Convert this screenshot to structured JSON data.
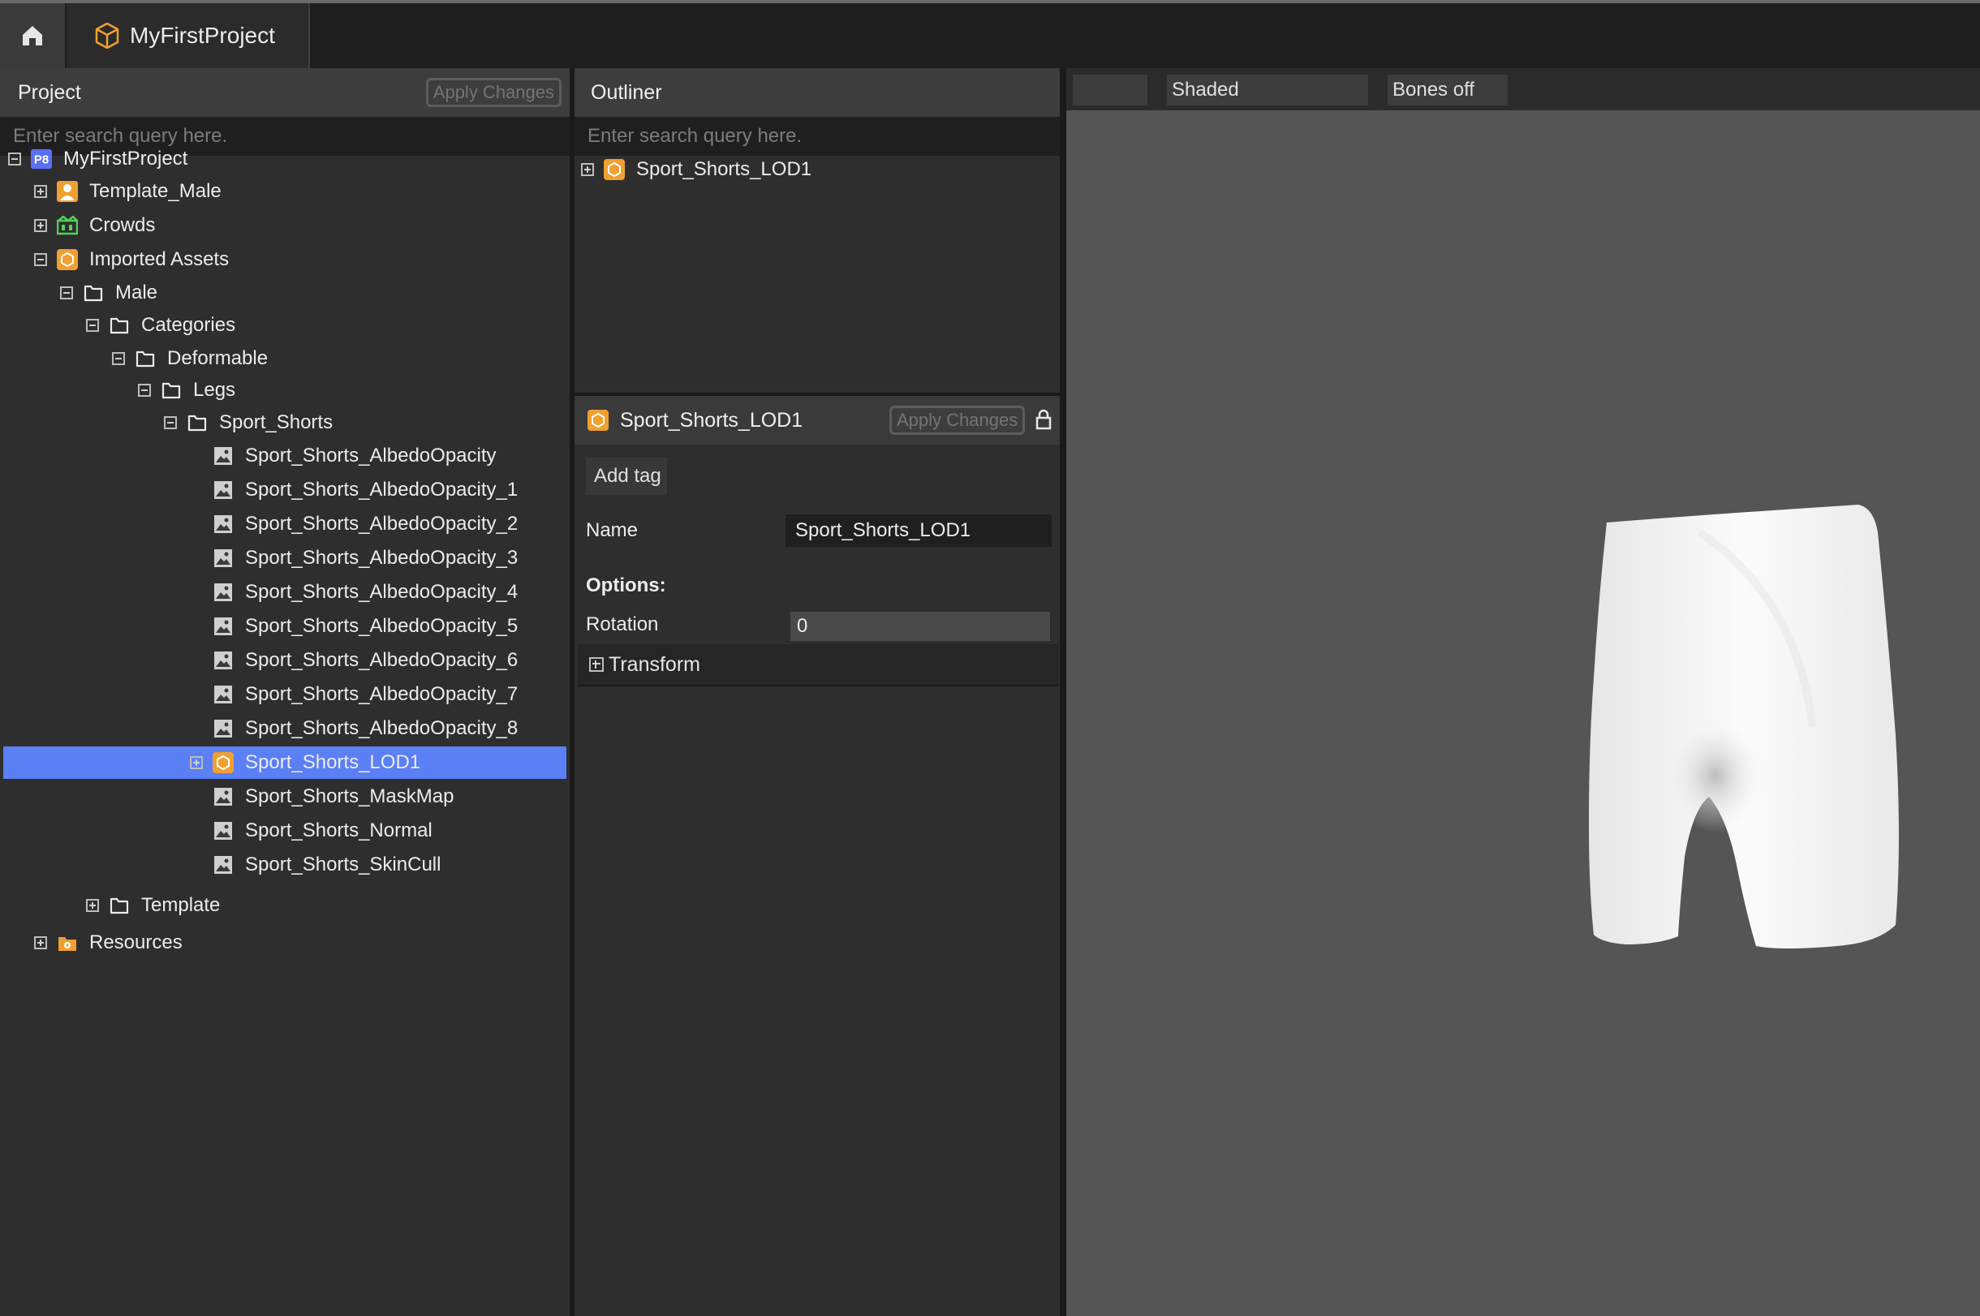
{
  "tabs": {
    "project_tab_label": "MyFirstProject"
  },
  "project_panel": {
    "title": "Project",
    "apply_label": "Apply Changes",
    "search_placeholder": "Enter search query here.",
    "tree": [
      {
        "label": "MyFirstProject",
        "icon": "p8-project-icon",
        "toggle": "minus"
      },
      {
        "label": "Template_Male",
        "icon": "person-icon",
        "toggle": "plus"
      },
      {
        "label": "Crowds",
        "icon": "crowds-icon",
        "toggle": "plus"
      },
      {
        "label": "Imported Assets",
        "icon": "hexagon-asset-icon",
        "toggle": "minus"
      },
      {
        "label": "Male",
        "icon": "folder-icon",
        "toggle": "minus"
      },
      {
        "label": "Categories",
        "icon": "folder-icon",
        "toggle": "minus"
      },
      {
        "label": "Deformable",
        "icon": "folder-icon",
        "toggle": "minus"
      },
      {
        "label": "Legs",
        "icon": "folder-icon",
        "toggle": "minus"
      },
      {
        "label": "Sport_Shorts",
        "icon": "folder-icon",
        "toggle": "minus"
      },
      {
        "label": "Sport_Shorts_AlbedoOpacity",
        "icon": "image-icon"
      },
      {
        "label": "Sport_Shorts_AlbedoOpacity_1",
        "icon": "image-icon"
      },
      {
        "label": "Sport_Shorts_AlbedoOpacity_2",
        "icon": "image-icon"
      },
      {
        "label": "Sport_Shorts_AlbedoOpacity_3",
        "icon": "image-icon"
      },
      {
        "label": "Sport_Shorts_AlbedoOpacity_4",
        "icon": "image-icon"
      },
      {
        "label": "Sport_Shorts_AlbedoOpacity_5",
        "icon": "image-icon"
      },
      {
        "label": "Sport_Shorts_AlbedoOpacity_6",
        "icon": "image-icon"
      },
      {
        "label": "Sport_Shorts_AlbedoOpacity_7",
        "icon": "image-icon"
      },
      {
        "label": "Sport_Shorts_AlbedoOpacity_8",
        "icon": "image-icon"
      },
      {
        "label": "Sport_Shorts_LOD1",
        "icon": "hexagon-asset-icon",
        "toggle": "plus",
        "selected": true
      },
      {
        "label": "Sport_Shorts_MaskMap",
        "icon": "image-icon"
      },
      {
        "label": "Sport_Shorts_Normal",
        "icon": "image-icon"
      },
      {
        "label": "Sport_Shorts_SkinCull",
        "icon": "image-icon"
      },
      {
        "label": "Template",
        "icon": "folder-icon",
        "toggle": "plus"
      },
      {
        "label": "Resources",
        "icon": "resources-icon",
        "toggle": "plus"
      }
    ]
  },
  "outliner": {
    "title": "Outliner",
    "search_placeholder": "Enter search query here.",
    "item_label": "Sport_Shorts_LOD1"
  },
  "inspector": {
    "title": "Sport_Shorts_LOD1",
    "apply_label": "Apply Changes",
    "add_tag_label": "Add tag",
    "name_label": "Name",
    "name_value": "Sport_Shorts_LOD1",
    "options_label": "Options:",
    "rotation_label": "Rotation",
    "rotation_value": "0",
    "transform_label": "Transform"
  },
  "viewport": {
    "shading_mode": "Shaded",
    "bones_mode": "Bones off"
  },
  "colors": {
    "accent": "#5b7ff5",
    "asset_orange": "#f0a030",
    "crowds_green": "#4fd25a"
  }
}
